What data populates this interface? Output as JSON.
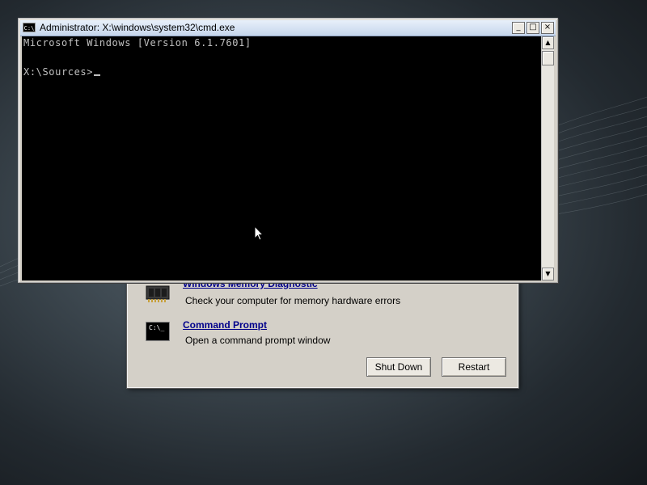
{
  "cmd_window": {
    "title": "Administrator: X:\\windows\\system32\\cmd.exe",
    "icon_label": "C:\\",
    "buttons": {
      "minimize": "_",
      "maximize": "□",
      "close": "×"
    },
    "console_lines": [
      "Microsoft Windows [Version 6.1.7601]",
      "",
      "X:\\Sources>"
    ],
    "scroll": {
      "up": "▲",
      "down": "▼"
    }
  },
  "recovery_dialog": {
    "tools": [
      {
        "name": "Windows Memory Diagnostic",
        "description": "Check your computer for memory hardware errors",
        "icon": "memory-chip-icon"
      },
      {
        "name": "Command Prompt",
        "description": "Open a command prompt window",
        "icon": "command-prompt-icon"
      }
    ],
    "command_icon_label": "C:\\_",
    "shutdown_label": "Shut Down",
    "restart_label": "Restart"
  }
}
